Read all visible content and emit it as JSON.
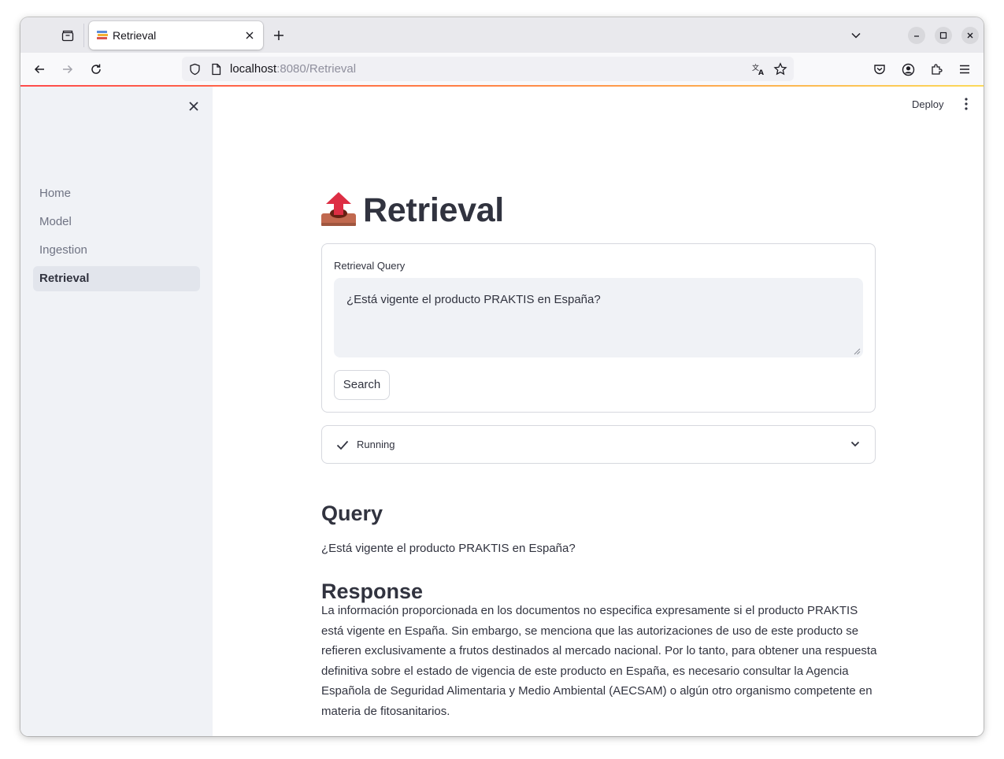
{
  "browser": {
    "tab": {
      "title": "Retrieval",
      "favicon": "stacked-books-icon"
    },
    "url": {
      "host": "localhost",
      "rest": ":8080/Retrieval"
    }
  },
  "sidebar": {
    "items": [
      {
        "label": "Home",
        "active": false
      },
      {
        "label": "Model",
        "active": false
      },
      {
        "label": "Ingestion",
        "active": false
      },
      {
        "label": "Retrieval",
        "active": true
      }
    ]
  },
  "header": {
    "deploy_label": "Deploy"
  },
  "page": {
    "title": "Retrieval",
    "title_icon": "outbox-tray-icon",
    "form": {
      "label": "Retrieval Query",
      "query_value": "¿Está vigente el producto PRAKTIS en España?",
      "search_label": "Search"
    },
    "status": {
      "label": "Running",
      "icon": "check-icon"
    },
    "query_section": {
      "heading": "Query",
      "text": "¿Está vigente el producto PRAKTIS en España?"
    },
    "response_section": {
      "heading": "Response",
      "text": "La información proporcionada en los documentos no especifica expresamente si el producto PRAKTIS está vigente en España. Sin embargo, se menciona que las autorizaciones de uso de este producto se refieren exclusivamente a frutos destinados al mercado nacional. Por lo tanto, para obtener una respuesta definitiva sobre el estado de vigencia de este producto en España, es necesario consultar la Agencia Española de Seguridad Alimentaria y Medio Ambiental (AECSAM) o algún otro organismo competente en materia de fitosanitarios."
    }
  },
  "colors": {
    "primary_text": "#31333f",
    "sidebar_bg": "#f0f2f6",
    "accent_red": "#ff4b4b"
  }
}
